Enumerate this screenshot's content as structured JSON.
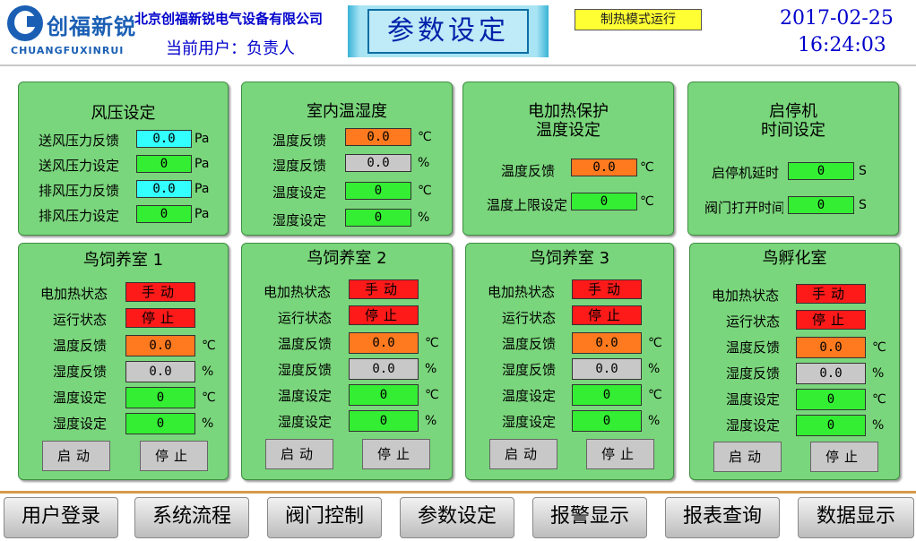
{
  "header": {
    "logo_cn": "创福新锐",
    "logo_en": "CHUANGFUXINRUI",
    "company": "北京创福新锐电气设备有限公司",
    "user_label": "当前用户：负责人",
    "title": "参数设定",
    "mode": "制热模式运行",
    "date": "2017-02-25",
    "time": "16:24:03"
  },
  "wind": {
    "title": "风压设定",
    "rows": [
      {
        "label": "送风压力反馈",
        "value": "0.0",
        "unit": "Pa"
      },
      {
        "label": "送风压力设定",
        "value": "0",
        "unit": "Pa"
      },
      {
        "label": "排风压力反馈",
        "value": "0.0",
        "unit": "Pa"
      },
      {
        "label": "排风压力设定",
        "value": "0",
        "unit": "Pa"
      }
    ]
  },
  "indoor": {
    "title": "室内温湿度",
    "rows": [
      {
        "label": "温度反馈",
        "value": "0.0",
        "unit": "℃"
      },
      {
        "label": "湿度反馈",
        "value": "0.0",
        "unit": "%"
      },
      {
        "label": "温度设定",
        "value": "0",
        "unit": "℃"
      },
      {
        "label": "湿度设定",
        "value": "0",
        "unit": "%"
      }
    ]
  },
  "heat": {
    "title1": "电加热保护",
    "title2": "温度设定",
    "rows": [
      {
        "label": "温度反馈",
        "value": "0.0",
        "unit": "℃"
      },
      {
        "label": "温度上限设定",
        "value": "0",
        "unit": "℃"
      }
    ]
  },
  "startstop": {
    "title1": "启停机",
    "title2": "时间设定",
    "rows": [
      {
        "label": "启停机延时",
        "value": "0",
        "unit": "S"
      },
      {
        "label": "阀门打开时间",
        "value": "0",
        "unit": "S"
      }
    ]
  },
  "rooms": [
    {
      "title": "鸟饲养室  1",
      "heater_label": "电加热状态",
      "heater": "手动",
      "run_label": "运行状态",
      "run": "停止",
      "temp_fb_label": "温度反馈",
      "temp_fb": "0.0",
      "hum_fb_label": "湿度反馈",
      "hum_fb": "0.0",
      "temp_set_label": "温度设定",
      "temp_set": "0",
      "hum_set_label": "湿度设定",
      "hum_set": "0",
      "start": "启动",
      "stop": "停止"
    },
    {
      "title": "鸟饲养室  2",
      "heater_label": "电加热状态",
      "heater": "手动",
      "run_label": "运行状态",
      "run": "停止",
      "temp_fb_label": "温度反馈",
      "temp_fb": "0.0",
      "hum_fb_label": "湿度反馈",
      "hum_fb": "0.0",
      "temp_set_label": "温度设定",
      "temp_set": "0",
      "hum_set_label": "湿度设定",
      "hum_set": "0",
      "start": "启动",
      "stop": "停止"
    },
    {
      "title": "鸟饲养室  3",
      "heater_label": "电加热状态",
      "heater": "手动",
      "run_label": "运行状态",
      "run": "停止",
      "temp_fb_label": "温度反馈",
      "temp_fb": "0.0",
      "hum_fb_label": "湿度反馈",
      "hum_fb": "0.0",
      "temp_set_label": "温度设定",
      "temp_set": "0",
      "hum_set_label": "湿度设定",
      "hum_set": "0",
      "start": "启动",
      "stop": "停止"
    },
    {
      "title": "鸟孵化室",
      "heater_label": "电加热状态",
      "heater": "手动",
      "run_label": "运行状态",
      "run": "停止",
      "temp_fb_label": "温度反馈",
      "temp_fb": "0.0",
      "hum_fb_label": "湿度反馈",
      "hum_fb": "0.0",
      "temp_set_label": "温度设定",
      "temp_set": "0",
      "hum_set_label": "湿度设定",
      "hum_set": "0",
      "start": "启动",
      "stop": "停止"
    }
  ],
  "units": {
    "celsius": "℃",
    "percent": "%"
  },
  "nav": [
    "用户登录",
    "系统流程",
    "阀门控制",
    "参数设定",
    "报警显示",
    "报表查询",
    "数据显示"
  ],
  "colors": {
    "panel": "#7ad67c",
    "field_feedback_air": "#33ffff",
    "field_set": "#33ee33",
    "field_temp_fb": "#ff7a1f",
    "field_hum_fb": "#c8c8c8",
    "status": "#ff1a1a",
    "mode": "#ffff33"
  }
}
